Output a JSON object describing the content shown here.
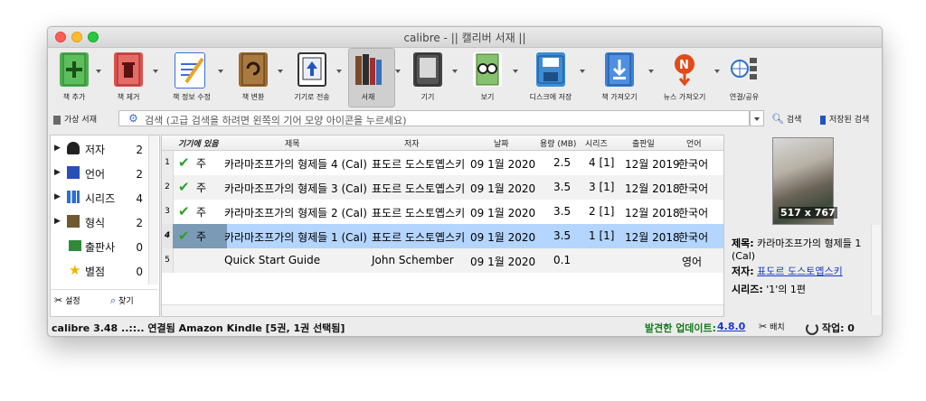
{
  "window": {
    "title": "calibre - || 캘리버 서재 ||"
  },
  "toolbar": {
    "items": [
      {
        "label": "책 추가",
        "icon": "add-book-icon",
        "color": "#4caf50"
      },
      {
        "label": "책 제거",
        "icon": "remove-book-icon",
        "color": "#d9534f"
      },
      {
        "label": "책 정보 수정",
        "icon": "edit-metadata-icon",
        "color": "#3b6fd8"
      },
      {
        "label": "책 변환",
        "icon": "convert-book-icon",
        "color": "#9c6b2f"
      },
      {
        "label": "기기로 전송",
        "icon": "send-to-device-icon",
        "color": "#2255bb"
      },
      {
        "label": "서재",
        "icon": "library-icon",
        "color": "#7a4a2a"
      },
      {
        "label": "기기",
        "icon": "device-icon",
        "color": "#555555"
      },
      {
        "label": "보기",
        "icon": "view-icon",
        "color": "#5aa845"
      },
      {
        "label": "디스크에 저장",
        "icon": "save-to-disk-icon",
        "color": "#3c8cd6"
      },
      {
        "label": "책 가져오기",
        "icon": "get-books-icon",
        "color": "#3b7fd8"
      },
      {
        "label": "뉴스 가져오기",
        "icon": "fetch-news-icon",
        "color": "#e04b1a"
      },
      {
        "label": "연결/공유",
        "icon": "connect-share-icon",
        "color": "#2d6fd0"
      }
    ]
  },
  "searchbar": {
    "virtual_library": "가상 서재",
    "placeholder": "검색 (고급 검색을 하려면 왼쪽의 기어 모양 아이콘을 누르세요)",
    "search_label": "검색",
    "saved_label": "저장된 검색"
  },
  "sidebar": {
    "items": [
      {
        "label": "저자",
        "count": "2",
        "icon": "author-icon"
      },
      {
        "label": "언어",
        "count": "2",
        "icon": "language-icon"
      },
      {
        "label": "시리즈",
        "count": "4",
        "icon": "series-icon"
      },
      {
        "label": "형식",
        "count": "2",
        "icon": "format-icon"
      },
      {
        "label": "출판사",
        "count": "0",
        "icon": "publisher-icon"
      },
      {
        "label": "별점",
        "count": "0",
        "icon": "rating-icon"
      }
    ],
    "settings_label": "설정",
    "find_label": "찾기"
  },
  "table": {
    "columns": [
      "기기에 있음",
      "제목",
      "저자",
      "날짜",
      "용량 (MB)",
      "시리즈",
      "출판일",
      "언어"
    ],
    "rows": [
      {
        "num": "1",
        "on_device": "주",
        "title": "카라마조프가의 형제들 4 (Cal)",
        "author": "표도르 도스토옙스키",
        "date": "09 1월 2020",
        "size": "2.5",
        "series": "4 [1]",
        "pubdate": "12월 2019",
        "lang": "한국어"
      },
      {
        "num": "2",
        "on_device": "주",
        "title": "카라마조프가의 형제들 3 (Cal)",
        "author": "표도르 도스토옙스키",
        "date": "09 1월 2020",
        "size": "3.5",
        "series": "3 [1]",
        "pubdate": "12월 2018",
        "lang": "한국어"
      },
      {
        "num": "3",
        "on_device": "주",
        "title": "카라마조프가의 형제들 2 (Cal)",
        "author": "표도르 도스토옙스키",
        "date": "09 1월 2020",
        "size": "3.5",
        "series": "2 [1]",
        "pubdate": "12월 2018",
        "lang": "한국어"
      },
      {
        "num": "4",
        "on_device": "주",
        "title": "카라마조프가의 형제들 1 (Cal)",
        "author": "표도르 도스토옙스키",
        "date": "09 1월 2020",
        "size": "3.5",
        "series": "1 [1]",
        "pubdate": "12월 2018",
        "lang": "한국어"
      },
      {
        "num": "5",
        "on_device": "",
        "title": "Quick Start Guide",
        "author": "John Schember",
        "date": "09 1월 2020",
        "size": "0.1",
        "series": "",
        "pubdate": "",
        "lang": "영어"
      }
    ]
  },
  "details": {
    "cover_size": "517 x 767",
    "title_key": "제목:",
    "title_value": "카라마조프가의 형제들 1 (Cal)",
    "author_key": "저자:",
    "author_value": "표도르 도스토옙스키",
    "series_key": "시리즈:",
    "series_value": "'1'의 1편"
  },
  "status": {
    "left": "calibre 3.48 ..::.. 연결됨 Amazon Kindle   [5권, 1권 선택됨]",
    "update_label": "발견한 업데이트:",
    "version": "4.8.0",
    "layout_label": "배치",
    "jobs": "작업: 0"
  }
}
